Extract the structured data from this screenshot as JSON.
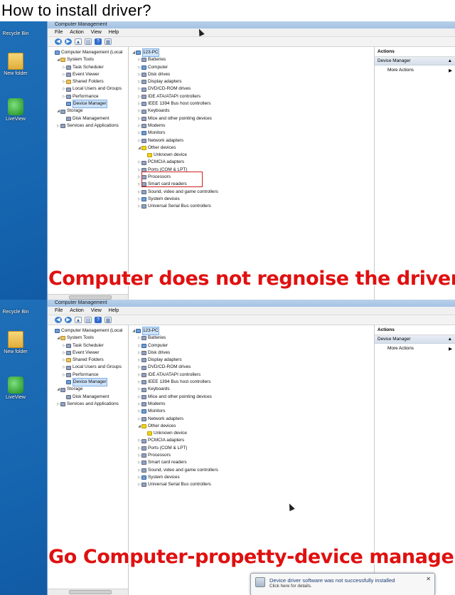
{
  "heading": "How to install driver?",
  "desktop": {
    "icons": [
      "Recycle Bin",
      "New folder",
      "LiveView"
    ]
  },
  "window": {
    "title": "Computer Management",
    "menu": [
      "File",
      "Action",
      "View",
      "Help"
    ],
    "left_tree": [
      {
        "label": "Computer Management (Local",
        "indent": 0,
        "tw": "",
        "icon": "pc"
      },
      {
        "label": "System Tools",
        "indent": 1,
        "tw": "◢",
        "icon": "folder"
      },
      {
        "label": "Task Scheduler",
        "indent": 2,
        "tw": "▷",
        "icon": ""
      },
      {
        "label": "Event Viewer",
        "indent": 2,
        "tw": "▷",
        "icon": ""
      },
      {
        "label": "Shared Folders",
        "indent": 2,
        "tw": "▷",
        "icon": "folder"
      },
      {
        "label": "Local Users and Groups",
        "indent": 2,
        "tw": "▷",
        "icon": ""
      },
      {
        "label": "Performance",
        "indent": 2,
        "tw": "▷",
        "icon": ""
      },
      {
        "label": "Device Manager",
        "indent": 2,
        "tw": "",
        "icon": "pc"
      },
      {
        "label": "Storage",
        "indent": 1,
        "tw": "◢",
        "icon": ""
      },
      {
        "label": "Disk Management",
        "indent": 2,
        "tw": "",
        "icon": ""
      },
      {
        "label": "Services and Applications",
        "indent": 1,
        "tw": "▷",
        "icon": ""
      }
    ],
    "device_tree": [
      {
        "label": "123-PC",
        "indent": 0,
        "tw": "◢",
        "icon": "pc"
      },
      {
        "label": "Batteries",
        "indent": 1,
        "tw": "▷",
        "icon": ""
      },
      {
        "label": "Computer",
        "indent": 1,
        "tw": "▷",
        "icon": "pc"
      },
      {
        "label": "Disk drives",
        "indent": 1,
        "tw": "▷",
        "icon": ""
      },
      {
        "label": "Display adapters",
        "indent": 1,
        "tw": "▷",
        "icon": ""
      },
      {
        "label": "DVD/CD-ROM drives",
        "indent": 1,
        "tw": "▷",
        "icon": ""
      },
      {
        "label": "IDE ATA/ATAPI controllers",
        "indent": 1,
        "tw": "▷",
        "icon": ""
      },
      {
        "label": "IEEE 1394 Bus host controllers",
        "indent": 1,
        "tw": "▷",
        "icon": ""
      },
      {
        "label": "Keyboards",
        "indent": 1,
        "tw": "▷",
        "icon": ""
      },
      {
        "label": "Mice and other pointing devices",
        "indent": 1,
        "tw": "▷",
        "icon": ""
      },
      {
        "label": "Modems",
        "indent": 1,
        "tw": "▷",
        "icon": ""
      },
      {
        "label": "Monitors",
        "indent": 1,
        "tw": "▷",
        "icon": "pc"
      },
      {
        "label": "Network adapters",
        "indent": 1,
        "tw": "▷",
        "icon": ""
      },
      {
        "label": "Other devices",
        "indent": 1,
        "tw": "◢",
        "icon": "warn"
      },
      {
        "label": "Unknown device",
        "indent": 2,
        "tw": "",
        "icon": "warn"
      },
      {
        "label": "PCMCIA adapters",
        "indent": 1,
        "tw": "▷",
        "icon": ""
      },
      {
        "label": "Ports (COM & LPT)",
        "indent": 1,
        "tw": "▷",
        "icon": ""
      },
      {
        "label": "Processors",
        "indent": 1,
        "tw": "▷",
        "icon": ""
      },
      {
        "label": "Smart card readers",
        "indent": 1,
        "tw": "▷",
        "icon": ""
      },
      {
        "label": "Sound, video and game controllers",
        "indent": 1,
        "tw": "▷",
        "icon": ""
      },
      {
        "label": "System devices",
        "indent": 1,
        "tw": "▷",
        "icon": "pc"
      },
      {
        "label": "Universal Serial Bus controllers",
        "indent": 1,
        "tw": "▷",
        "icon": ""
      }
    ],
    "actions": {
      "title": "Actions",
      "section": "Device Manager",
      "more": "More Actions"
    }
  },
  "captions": {
    "top": "Computer does not regnoise the driver",
    "bottom": "Go Computer-propetty-device manager"
  },
  "notification": {
    "title": "Device driver software was not successfully installed",
    "subtitle": "Click here for details."
  }
}
